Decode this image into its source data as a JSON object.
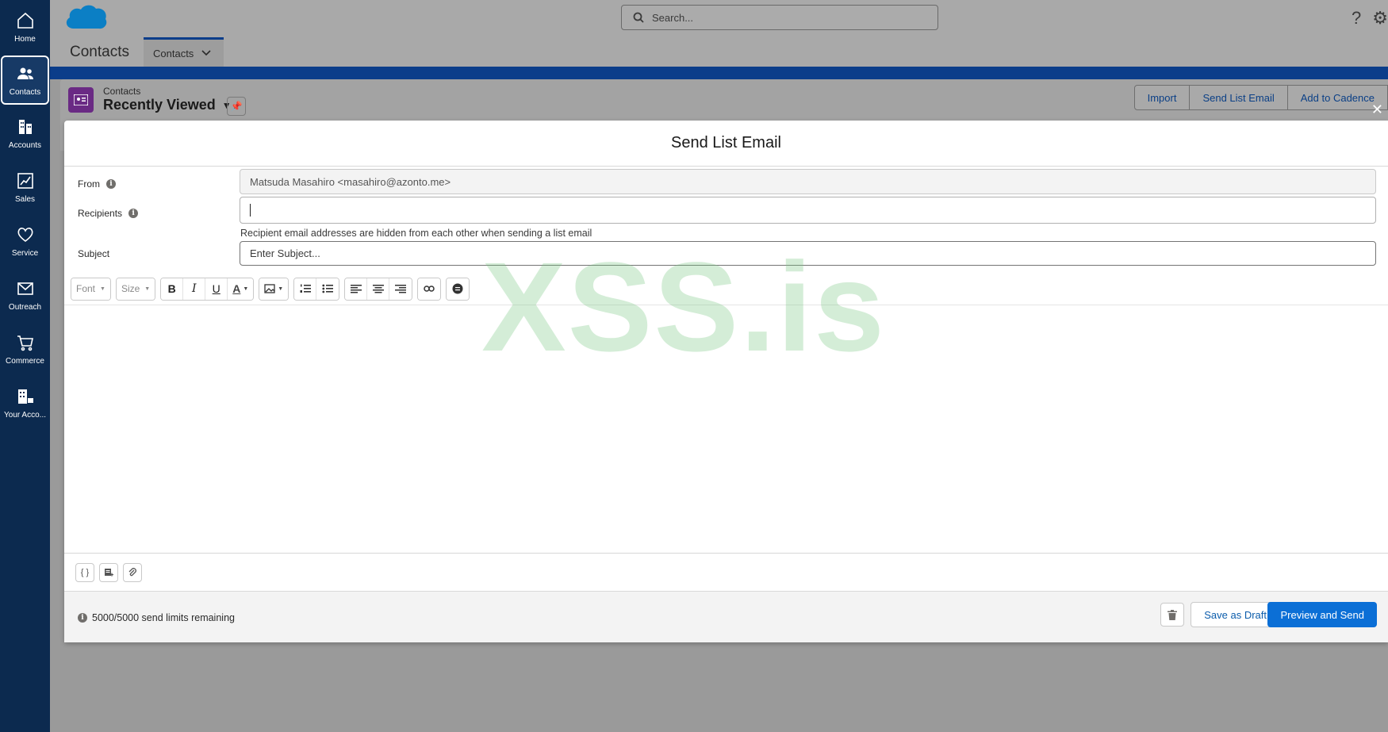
{
  "nav": {
    "items": [
      {
        "label": "Home",
        "icon": "home-icon"
      },
      {
        "label": "Contacts",
        "icon": "contacts-icon",
        "active": true
      },
      {
        "label": "Accounts",
        "icon": "building-icon"
      },
      {
        "label": "Sales",
        "icon": "chart-icon"
      },
      {
        "label": "Service",
        "icon": "heart-icon"
      },
      {
        "label": "Outreach",
        "icon": "mail-icon"
      },
      {
        "label": "Commerce",
        "icon": "cart-icon"
      },
      {
        "label": "Your Acco...",
        "icon": "store-icon"
      }
    ]
  },
  "header": {
    "search_placeholder": "Search...",
    "app_name": "Contacts",
    "tab_label": "Contacts"
  },
  "list": {
    "object_label": "Contacts",
    "view_name": "Recently Viewed",
    "buttons": [
      "Import",
      "Send List Email",
      "Add to Cadence"
    ]
  },
  "modal": {
    "title": "Send List Email",
    "from_label": "From",
    "from_value": "Matsuda Masahiro <masahiro@azonto.me>",
    "recipients_label": "Recipients",
    "recipients_value": "",
    "recipients_hint": "Recipient email addresses are hidden from each other when sending a list email",
    "subject_label": "Subject",
    "subject_placeholder": "Enter Subject...",
    "toolbar": {
      "font": "Font",
      "size": "Size"
    },
    "limits": "5000/5000 send limits remaining",
    "save_draft": "Save as Draft",
    "preview_send": "Preview and Send"
  },
  "watermark": "XSS.is",
  "colors": {
    "nav_bg": "#0c2a4f",
    "brand_blue": "#0b6fd6",
    "contacts_icon": "#6a2a84"
  }
}
